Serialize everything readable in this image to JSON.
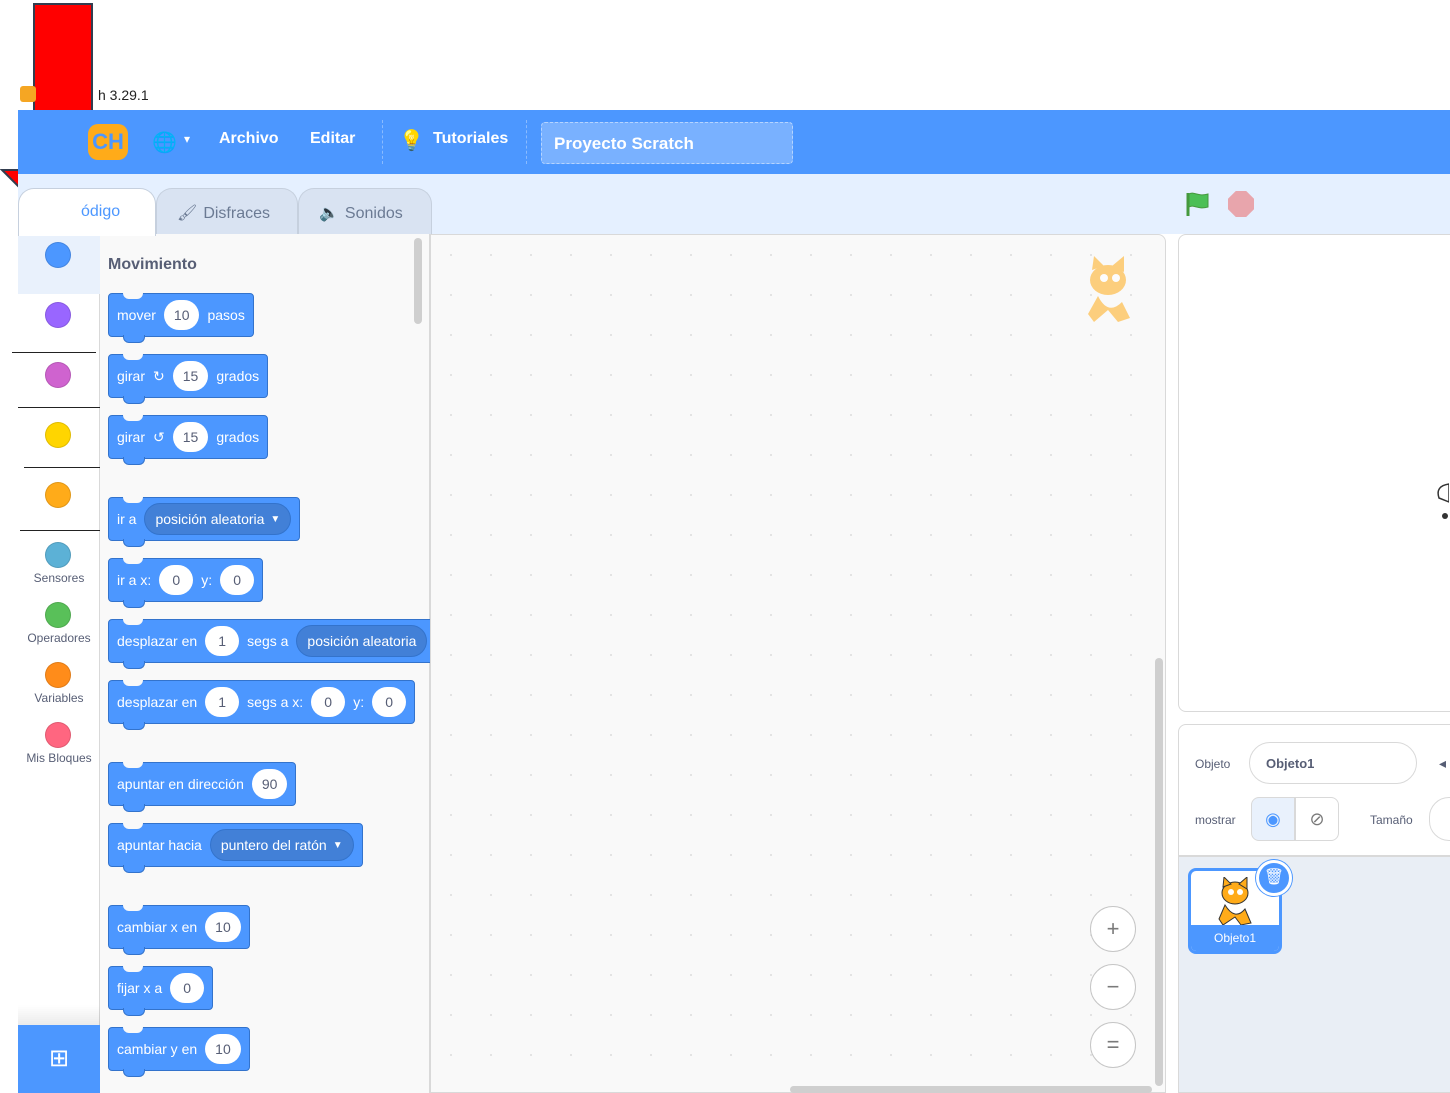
{
  "window": {
    "title": "h 3.29.1"
  },
  "menubar": {
    "logo_text": "CH",
    "globe_caret": "▾",
    "file": "Archivo",
    "edit": "Editar",
    "tutorials": "Tutoriales",
    "project_title": "Proyecto Scratch"
  },
  "tabs": {
    "code": "ódigo",
    "costumes": "Disfraces",
    "sounds": "Sonidos"
  },
  "categories": [
    {
      "label": "",
      "color": "#4c97ff"
    },
    {
      "label": "",
      "color": "#9966ff"
    },
    {
      "label": "",
      "color": "#cf63cf"
    },
    {
      "label": "",
      "color": "#ffd500"
    },
    {
      "label": "",
      "color": "#ffab19"
    },
    {
      "label": "Sensores",
      "color": "#5cb1d6"
    },
    {
      "label": "Operadores",
      "color": "#59c059"
    },
    {
      "label": "Variables",
      "color": "#ff8c1a"
    },
    {
      "label": "Mis Bloques",
      "color": "#ff6680"
    }
  ],
  "palette": {
    "section_title": "Movimiento",
    "blocks": {
      "move": {
        "a": "mover",
        "v": "10",
        "b": "pasos"
      },
      "turn_right": {
        "a": "girar",
        "icon": "↻",
        "v": "15",
        "b": "grados"
      },
      "turn_left": {
        "a": "girar",
        "icon": "↺",
        "v": "15",
        "b": "grados"
      },
      "goto": {
        "a": "ir a",
        "drop": "posición aleatoria"
      },
      "goto_xy": {
        "a": "ir a x:",
        "x": "0",
        "ylbl": "y:",
        "y": "0"
      },
      "glide_to": {
        "a": "desplazar en",
        "v": "1",
        "b": "segs a",
        "drop": "posición aleatoria"
      },
      "glide_xy": {
        "a": "desplazar en",
        "v": "1",
        "b": "segs a x:",
        "x": "0",
        "ylbl": "y:",
        "y": "0"
      },
      "point_dir": {
        "a": "apuntar en dirección",
        "v": "90"
      },
      "point_towards": {
        "a": "apuntar hacia",
        "drop": "puntero del ratón"
      },
      "change_x": {
        "a": "cambiar x en",
        "v": "10"
      },
      "set_x": {
        "a": "fijar x a",
        "v": "0"
      },
      "change_y": {
        "a": "cambiar y en",
        "v": "10"
      }
    }
  },
  "workspace": {
    "zoom_in": "+",
    "zoom_out": "−",
    "zoom_reset": "="
  },
  "sprite_info": {
    "sprite_label": "Objeto",
    "sprite_name": "Objeto1",
    "show_label": "mostrar",
    "size_label": "Tamaño"
  },
  "sprite_list": {
    "items": [
      {
        "name": "Objeto1"
      }
    ]
  },
  "colors": {
    "accent": "#4c97ff",
    "arrow": "#ff0000"
  }
}
